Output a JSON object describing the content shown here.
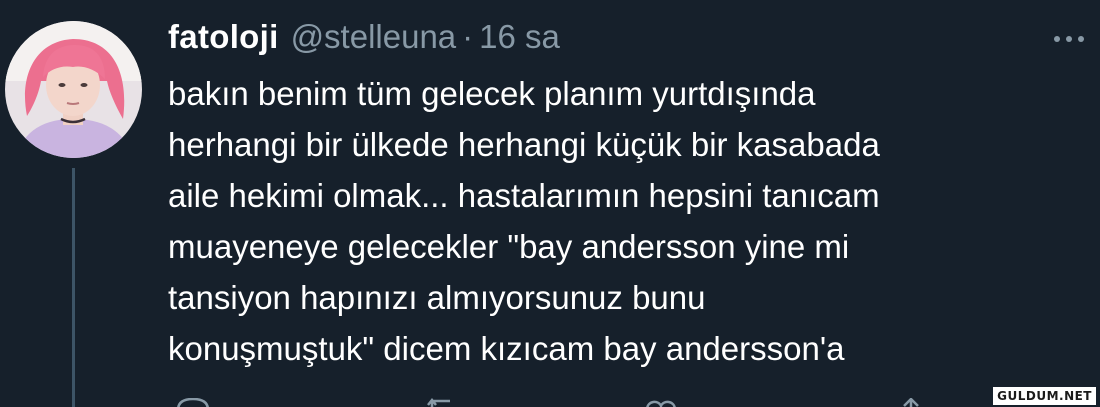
{
  "tweet": {
    "display_name": "fatoloji",
    "handle": "@stelleuna",
    "separator": "·",
    "time": "16 sa",
    "text_lines": [
      "bakın benim tüm gelecek planım yurtdışında",
      "herhangi bir ülkede herhangi küçük bir kasabada",
      "aile hekimi olmak... hastalarımın hepsini tanıcam",
      "muayeneye gelecekler \"bay andersson yine mi",
      "tansiyon hapınızı almıyorsunuz bunu",
      "konuşmuştuk\" dicem kızıcam bay andersson'a"
    ],
    "icons": {
      "avatar": "avatar-photo",
      "more": "more-icon",
      "reply": "reply-icon",
      "retweet": "retweet-icon",
      "like": "like-icon",
      "share": "share-icon"
    }
  },
  "watermark": "GULDUM.NET",
  "colors": {
    "background": "#16202b",
    "text": "#ffffff",
    "secondary": "#8899a6",
    "thread_line": "#3d5466",
    "avatar_hair": "#f07894"
  }
}
